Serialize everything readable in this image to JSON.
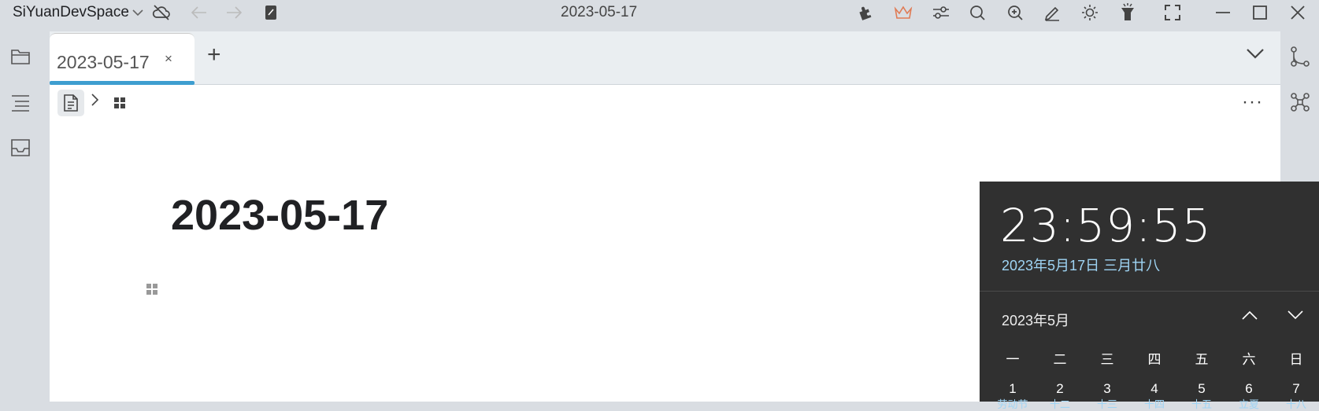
{
  "titlebar": {
    "workspace": "SiYuanDevSpace",
    "title": "2023-05-17"
  },
  "tabs": [
    {
      "label": "2023-05-17",
      "close": "×"
    }
  ],
  "tab_add": "+",
  "editor": {
    "doc_title": "2023-05-17",
    "more": "···"
  },
  "clock": {
    "time": "23:59:55",
    "date": "2023年5月17日 三月廿八",
    "month_label": "2023年5月",
    "weekdays": [
      "一",
      "二",
      "三",
      "四",
      "五",
      "六",
      "日"
    ],
    "days": [
      "1",
      "2",
      "3",
      "4",
      "5",
      "6",
      "7"
    ],
    "lunar": [
      "劳动节",
      "十二",
      "十三",
      "十四",
      "十五",
      "立夏",
      "十八"
    ]
  },
  "colors": {
    "accent": "#3e9ed0",
    "sync_icon": "#e07b55",
    "clock_bg": "#303030",
    "clock_date": "#9fd5f5"
  },
  "icons": [
    "chevron-down-icon",
    "cloud-off-icon",
    "back-icon",
    "forward-icon",
    "notebook-icon",
    "plugin-icon",
    "vip-crown-icon",
    "settings-sliders-icon",
    "search-icon",
    "zoom-icon",
    "edit-icon",
    "theme-sun-icon",
    "flashlight-icon",
    "fullscreen-icon",
    "minimize-icon",
    "maximize-icon",
    "close-icon",
    "folder-icon",
    "outline-icon",
    "inbox-icon",
    "backlink-icon",
    "graph-icon",
    "doc-icon",
    "chevron-right-icon",
    "blocks-icon"
  ]
}
